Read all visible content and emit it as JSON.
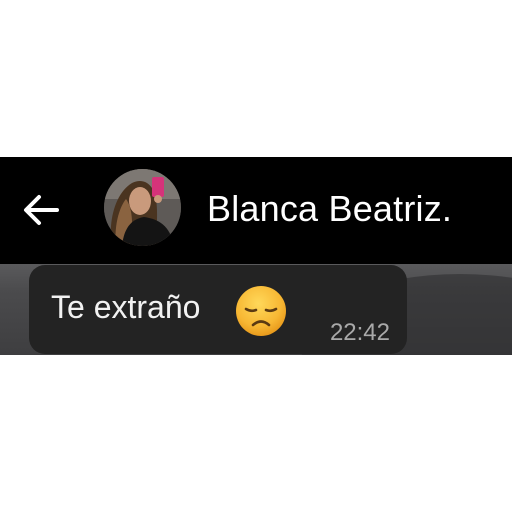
{
  "header": {
    "back_icon": "arrow-left-icon",
    "avatar_icon": "contact-avatar",
    "contact_name": "Blanca Beatriz."
  },
  "message": {
    "text": "Te extraño",
    "emoji": "disappointed-face-icon",
    "time": "22:42"
  },
  "colors": {
    "header_bg": "#000000",
    "bubble_bg": "#232323",
    "text": "#f2f2f2",
    "time": "#a9a9a9",
    "emoji": "#f7b733"
  }
}
